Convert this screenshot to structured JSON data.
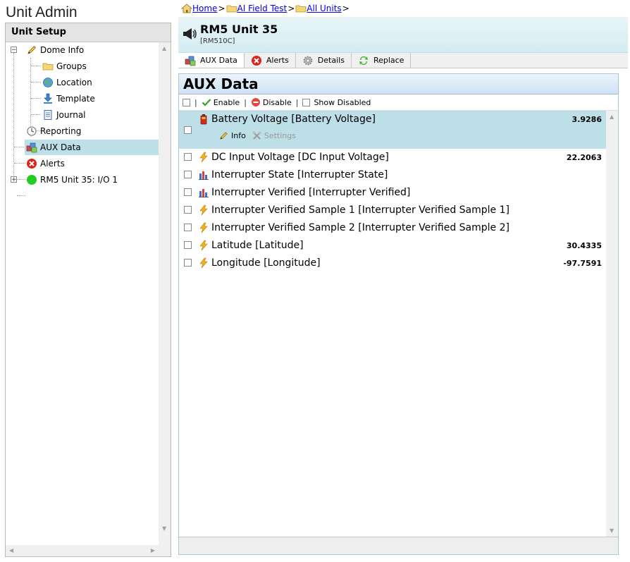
{
  "app": {
    "title": "Unit Admin"
  },
  "left_panel": {
    "header": "Unit Setup",
    "tree": [
      {
        "label": "Dome Info",
        "icon": "pencil-icon"
      },
      {
        "label": "Groups",
        "icon": "folder-icon"
      },
      {
        "label": "Location",
        "icon": "globe-icon"
      },
      {
        "label": "Template",
        "icon": "download-arrow-icon"
      },
      {
        "label": "Journal",
        "icon": "journal-icon"
      },
      {
        "label": "Reporting",
        "icon": "clock-icon"
      },
      {
        "label": "AUX Data",
        "icon": "aux-cube-icon"
      },
      {
        "label": "Alerts",
        "icon": "red-x-icon"
      },
      {
        "label": "RM5 Unit 35: I/O 1",
        "icon": "green-dot-icon"
      }
    ],
    "expanders": {
      "collapse": "−",
      "expand": "+"
    }
  },
  "breadcrumb": [
    {
      "label": "Home",
      "icon": "home-icon"
    },
    {
      "label": "AI Field Test",
      "icon": "folder-icon"
    },
    {
      "label": "All Units",
      "icon": "folder-icon"
    }
  ],
  "breadcrumb_sep": ">",
  "unit": {
    "title": "RM5 Unit 35",
    "subtitle": "[RM510C]",
    "icon": "megaphone-icon"
  },
  "tabs": [
    {
      "label": "AUX Data",
      "icon": "aux-cube-icon"
    },
    {
      "label": "Alerts",
      "icon": "red-x-icon"
    },
    {
      "label": "Details",
      "icon": "gear-icon"
    },
    {
      "label": "Replace",
      "icon": "refresh-icon"
    }
  ],
  "aux": {
    "title": "AUX Data",
    "toolbar": {
      "sep": "|",
      "enable_label": "Enable",
      "disable_label": "Disable",
      "show_disabled_label": "Show Disabled"
    },
    "row_actions": {
      "info_label": "Info",
      "settings_label": "Settings"
    },
    "rows": [
      {
        "label": "Battery Voltage [Battery Voltage]",
        "value": "3.9286",
        "icon": "battery-icon"
      },
      {
        "label": "DC Input Voltage [DC Input Voltage]",
        "value": "22.2063",
        "icon": "lightning-icon"
      },
      {
        "label": "Interrupter State [Interrupter State]",
        "value": "",
        "icon": "bar-chart-icon"
      },
      {
        "label": "Interrupter Verified [Interrupter Verified]",
        "value": "",
        "icon": "bar-chart-icon"
      },
      {
        "label": "Interrupter Verified Sample 1 [Interrupter Verified Sample 1]",
        "value": "",
        "icon": "lightning-icon"
      },
      {
        "label": "Interrupter Verified Sample 2 [Interrupter Verified Sample 2]",
        "value": "",
        "icon": "lightning-icon"
      },
      {
        "label": "Latitude [Latitude]",
        "value": "30.4335",
        "icon": "lightning-icon"
      },
      {
        "label": "Longitude [Longitude]",
        "value": "-97.7591",
        "icon": "lightning-icon"
      }
    ]
  },
  "colors": {
    "selection": "#bcdfe8",
    "header_gradient_top": "#e9f5f8",
    "link": "#0000ee",
    "lightning": "#f2b31b",
    "alert_red": "#d9261c",
    "status_green": "#22cc22"
  }
}
